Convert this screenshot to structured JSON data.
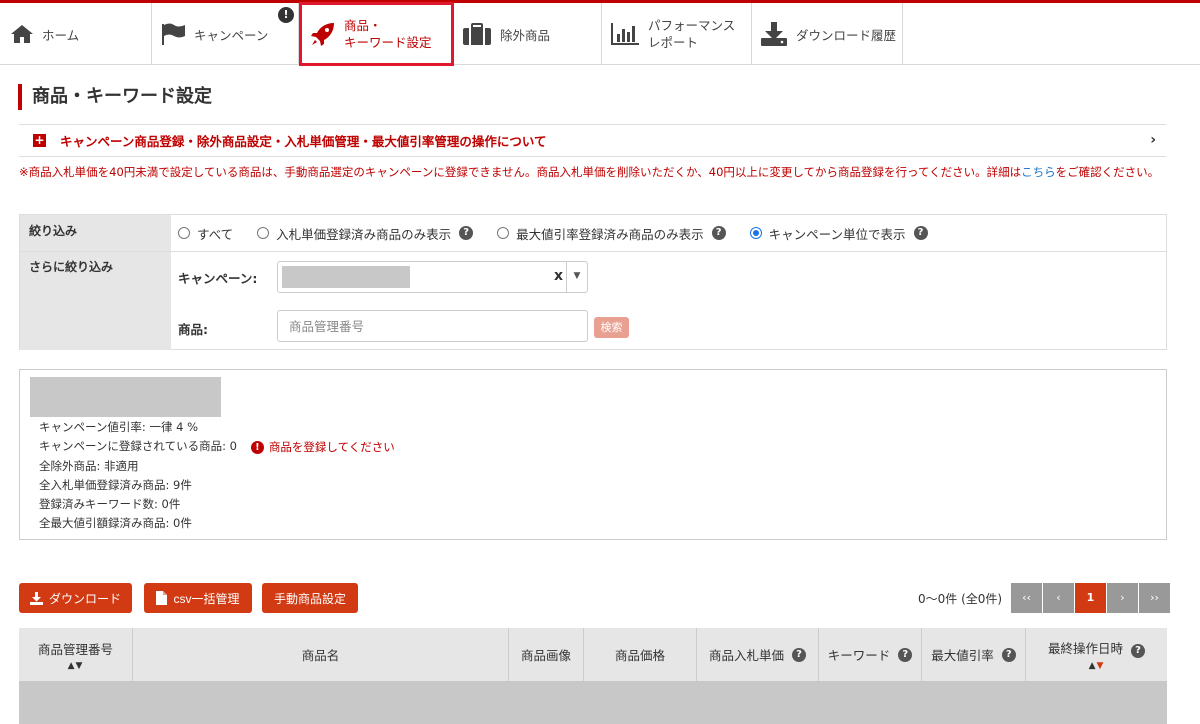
{
  "nav": {
    "items": [
      {
        "label": "ホーム",
        "icon": "home-icon"
      },
      {
        "label": "キャンペーン",
        "icon": "flag-icon",
        "badge": "!"
      },
      {
        "label_line1": "商品・",
        "label_line2": "キーワード設定",
        "icon": "rocket-icon",
        "active": true
      },
      {
        "label": "除外商品",
        "icon": "briefcase-icon"
      },
      {
        "label_line1": "パフォーマンス",
        "label_line2": "レポート",
        "icon": "bar-chart-icon"
      },
      {
        "label": "ダウンロード履歴",
        "icon": "download-icon"
      }
    ]
  },
  "page_title": "商品・キーワード設定",
  "accordion": {
    "plus": "+",
    "text": "キャンペーン商品登録・除外商品設定・入札単価管理・最大値引率管理の操作について",
    "chevron": "›"
  },
  "notice": {
    "text_before": "※商品入札単価を40円未満で設定している商品は、手動商品選定のキャンペーンに登録できません。商品入札単価を削除いただくか、40円以上に変更してから商品登録を行ってください。詳細は",
    "link": "こちら",
    "text_after": "をご確認ください。"
  },
  "filter": {
    "label": "絞り込み",
    "options": [
      {
        "label": "すべて",
        "help": false,
        "checked": false
      },
      {
        "label": "入札単価登録済み商品のみ表示",
        "help": true,
        "checked": false
      },
      {
        "label": "最大値引率登録済み商品のみ表示",
        "help": true,
        "checked": false
      },
      {
        "label": "キャンペーン単位で表示",
        "help": true,
        "checked": true
      }
    ],
    "help_glyph": "?",
    "refine_label": "さらに絞り込み",
    "campaign_label": "キャンペーン:",
    "campaign_clear": "x",
    "product_label": "商品:",
    "product_placeholder": "商品管理番号",
    "search_button": "検索"
  },
  "info": {
    "discount": "キャンペーン値引率: 一律 4 %",
    "registered": "キャンペーンに登録されている商品: 0",
    "warning": "商品を登録してください",
    "warning_glyph": "!",
    "excluded": "全除外商品: 非適用",
    "bid_registered": "全入札単価登録済み商品: 9件",
    "keywords": "登録済みキーワード数: 0件",
    "max_discount": "全最大値引額録済み商品: 0件"
  },
  "actions": {
    "download": "ダウンロード",
    "csv": "csv一括管理",
    "manual": "手動商品設定"
  },
  "pagination": {
    "count": "0〜0件 (全0件)",
    "first": "‹‹",
    "prev": "‹",
    "current": "1",
    "next": "›",
    "last": "››"
  },
  "table": {
    "columns": [
      {
        "label": "商品管理番号",
        "sort": "▲▼"
      },
      {
        "label": "商品名"
      },
      {
        "label": "商品画像"
      },
      {
        "label": "商品価格"
      },
      {
        "label": "商品入札単価",
        "help": true
      },
      {
        "label": "キーワード",
        "help": true
      },
      {
        "label": "最大値引率",
        "help": true
      },
      {
        "label": "最終操作日時",
        "help": true,
        "sort": "▲▼"
      }
    ]
  },
  "colors": {
    "brand_red": "#bf0000",
    "button_red": "#d23a14",
    "radio_blue": "#1a73e8",
    "link_blue": "#1a73c7"
  }
}
